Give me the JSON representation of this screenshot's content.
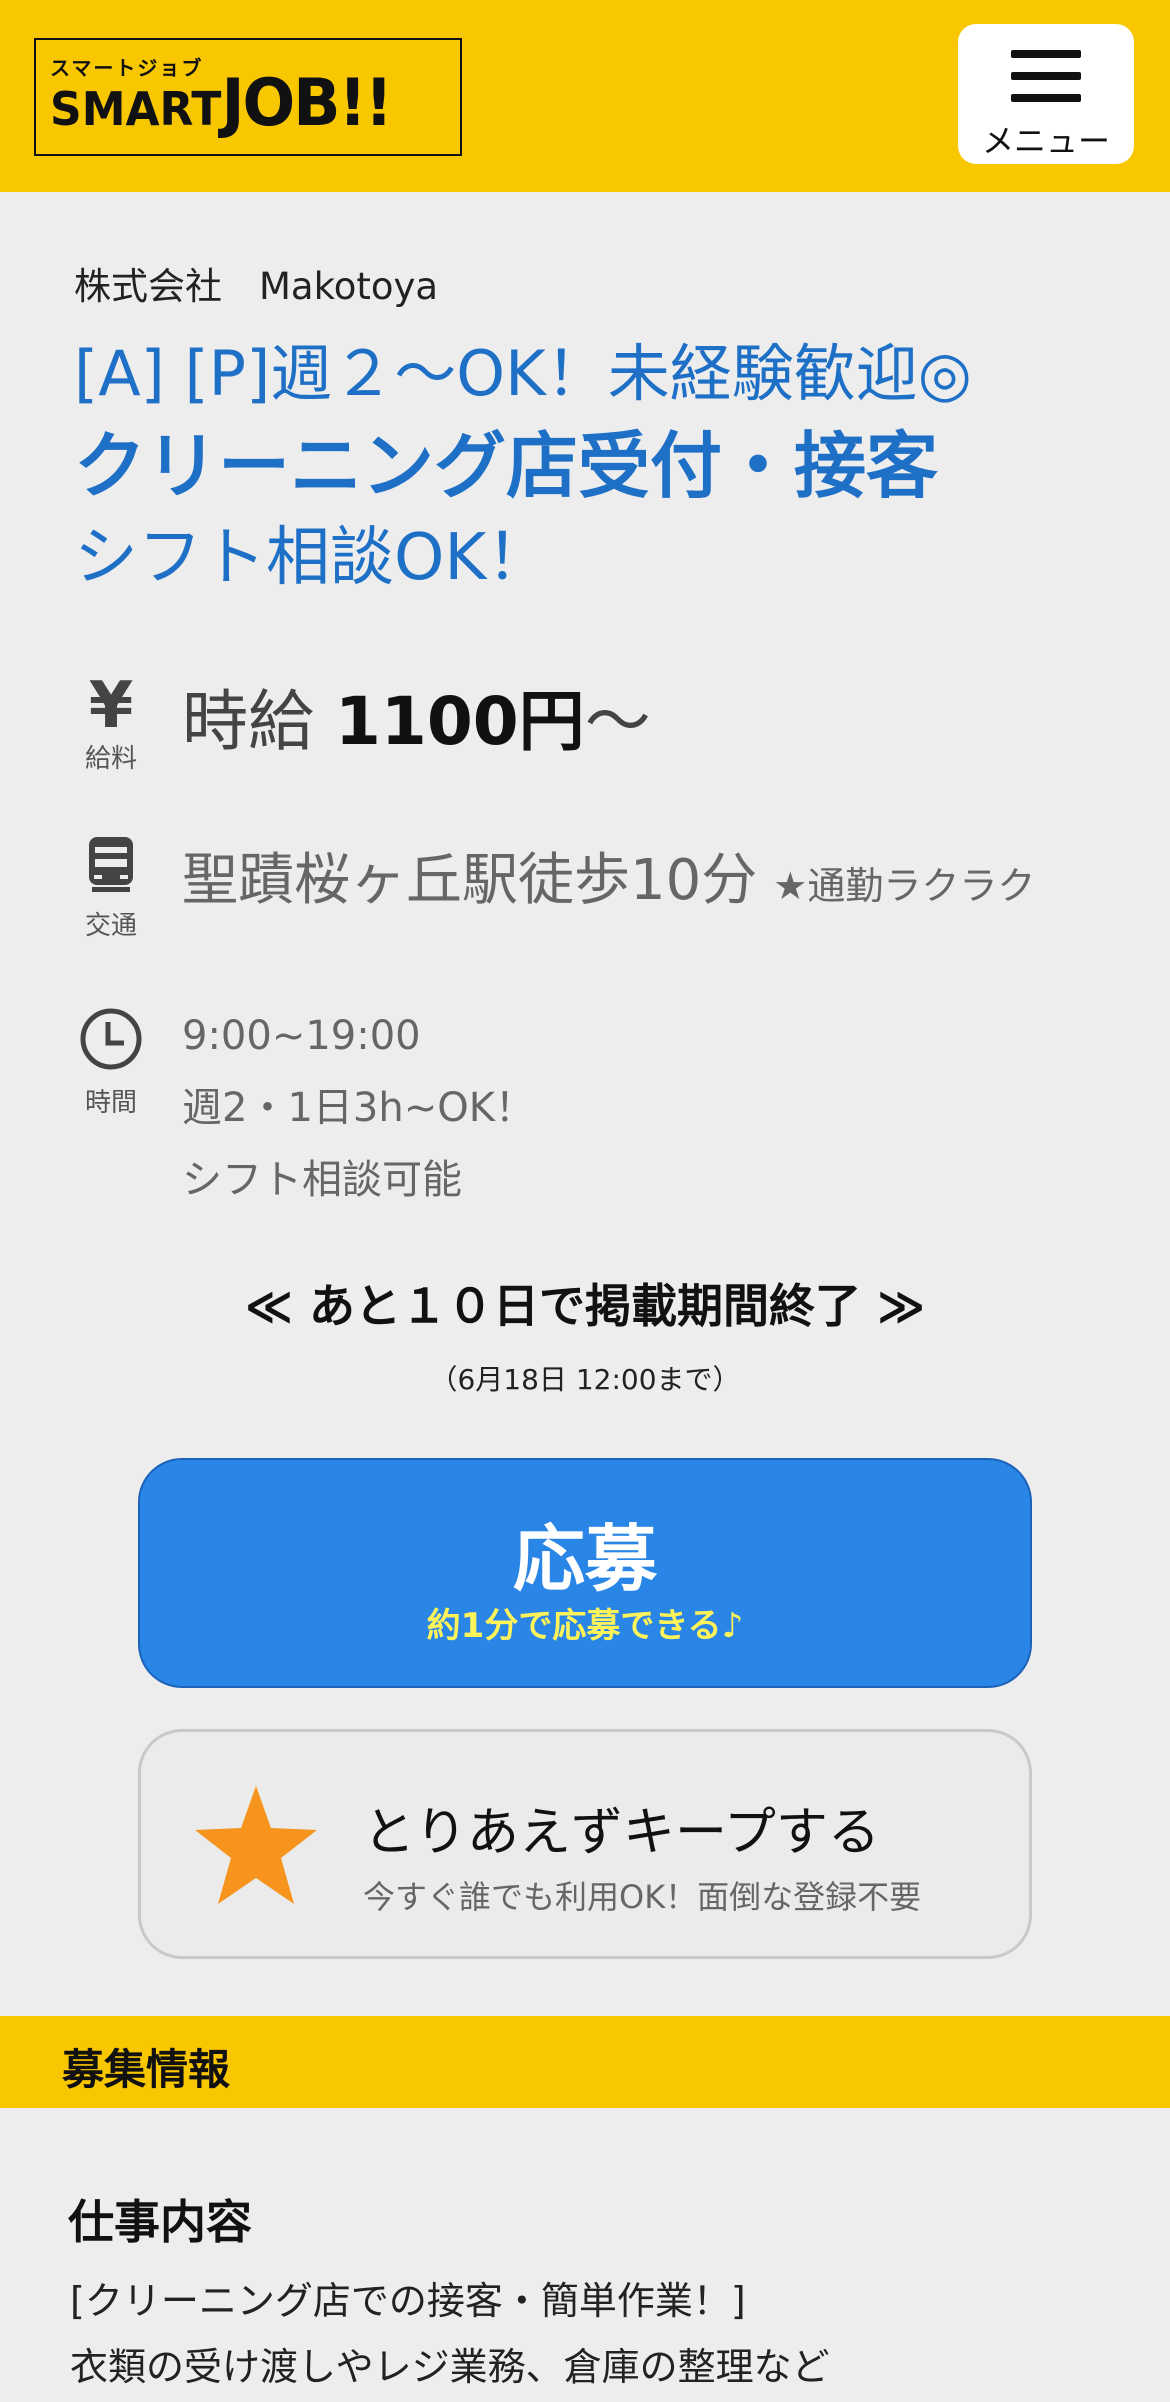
{
  "header": {
    "logo_kana": "スマートジョブ",
    "logo_word": "SMART",
    "logo_word_big": "JOB!!",
    "menu_label": "メニュー"
  },
  "job": {
    "company": "株式会社　Makotoya",
    "title_line1": "[A] [P]週２～OK！未経験歓迎◎",
    "title_line2": "クリーニング店受付・接客",
    "title_line3": "シフト相談OK！"
  },
  "salary": {
    "icon_caption": "給料",
    "prefix": "時給 ",
    "amount": "1100円",
    "suffix": "～"
  },
  "access": {
    "icon_caption": "交通",
    "station": "聖蹟桜ヶ丘駅徒歩10分",
    "note": "★通勤ラクラク"
  },
  "hours": {
    "icon_caption": "時間",
    "lines": [
      "9:00~19:00",
      "週2・1日3h~OK！",
      "シフト相談可能"
    ]
  },
  "deadline": {
    "text": "≪ あと１０日で掲載期間終了 ≫",
    "sub": "（6月18日 12:00まで）"
  },
  "apply": {
    "label": "応募",
    "sub": "約1分で応募できる♪"
  },
  "keep": {
    "label": "とりあえずキープする",
    "sub": "今すぐ誰でも利用OK！面倒な登録不要"
  },
  "section": {
    "bar_title": "募集情報",
    "heading": "仕事内容",
    "desc": [
      "[クリーニング店での接客・簡単作業！]",
      "衣類の受け渡しやレジ業務、倉庫の整理など"
    ]
  },
  "colors": {
    "brand_yellow": "#f9c700",
    "title_blue": "#1e6fc6",
    "apply_blue": "#2a86e6",
    "apply_sub_yellow": "#fff35a",
    "star_orange": "#f7941d"
  }
}
